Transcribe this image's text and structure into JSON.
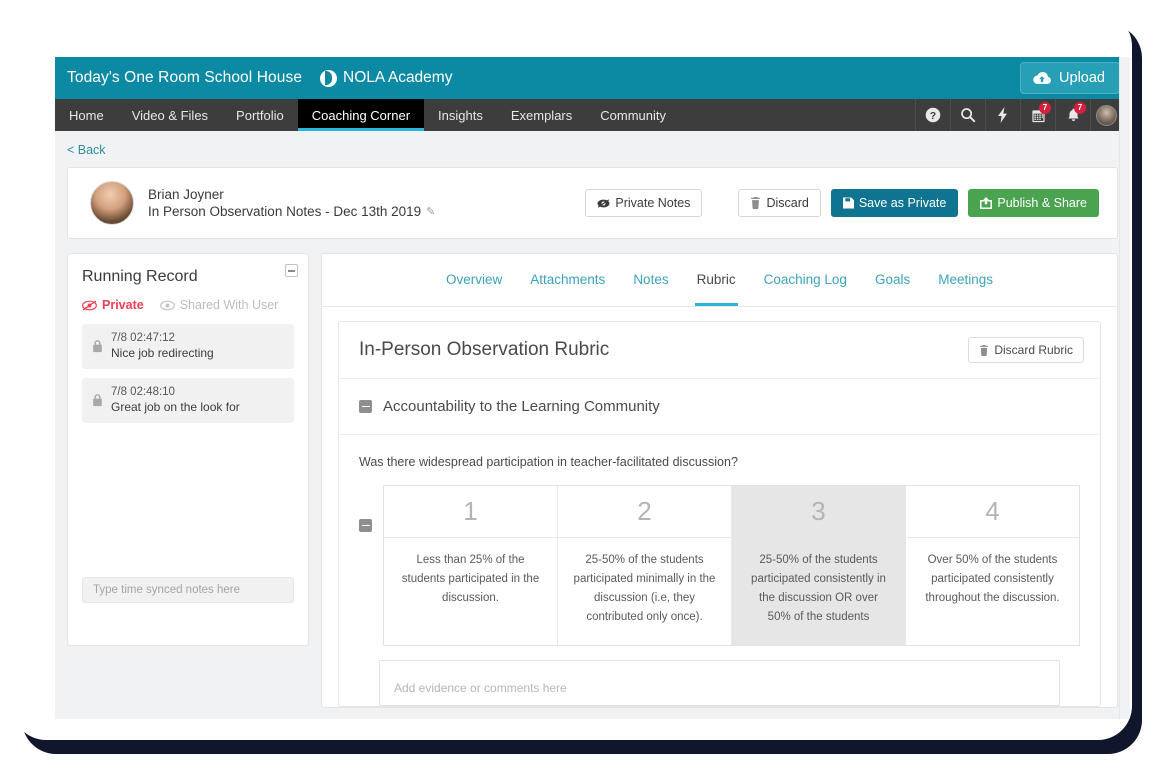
{
  "topbar": {
    "school_name": "Today's One Room School House",
    "academy_name": "NOLA Academy",
    "academy_logo_icon": "split-circle-logo",
    "upload_label": "Upload",
    "upload_icon": "cloud-upload-icon",
    "accent_teal": "#0d8aa3"
  },
  "nav": {
    "items": [
      {
        "label": "Home",
        "active": false
      },
      {
        "label": "Video & Files",
        "active": false
      },
      {
        "label": "Portfolio",
        "active": false
      },
      {
        "label": "Coaching Corner",
        "active": true
      },
      {
        "label": "Insights",
        "active": false
      },
      {
        "label": "Exemplars",
        "active": false
      },
      {
        "label": "Community",
        "active": false
      }
    ],
    "icons": [
      {
        "name": "help-icon",
        "badge": ""
      },
      {
        "name": "search-icon",
        "badge": ""
      },
      {
        "name": "lightning-icon",
        "badge": ""
      },
      {
        "name": "calendar-icon",
        "badge": "7"
      },
      {
        "name": "bell-icon",
        "badge": "7"
      }
    ],
    "avatar_icon": "user-avatar",
    "caret_icon": "chevron-down-icon",
    "active_underline_color": "#29b6d8",
    "badge_color": "#d6203b"
  },
  "back": {
    "label": "< Back"
  },
  "profile": {
    "avatar_icon": "user-avatar",
    "name": "Brian Joyner",
    "subtitle": "In Person Observation Notes - Dec 13th 2019",
    "edit_icon": "pencil-icon",
    "buttons": [
      {
        "label": "Private Notes",
        "icon": "eye-slash-icon",
        "style": "light"
      },
      {
        "label": "Discard",
        "icon": "trash-icon",
        "style": "light"
      },
      {
        "label": "Save as Private",
        "icon": "floppy-disk-icon",
        "style": "teal"
      },
      {
        "label": "Publish & Share",
        "icon": "share-icon",
        "style": "green"
      }
    ]
  },
  "sidebar": {
    "title": "Running Record",
    "collapse_icon": "collapse-minus-icon",
    "privacy": {
      "private_label": "Private",
      "private_icon": "eye-slash-icon",
      "private_color": "#ef4055",
      "shared_label": "Shared With User",
      "shared_icon": "eye-open-icon"
    },
    "notes": [
      {
        "time": "7/8  02:47:12",
        "text": "Nice job redirecting",
        "icon": "lock-icon"
      },
      {
        "time": "7/8  02:48:10",
        "text": "Great job on the look for",
        "icon": "lock-icon"
      }
    ],
    "note_input_placeholder": "Type time synced notes here"
  },
  "main": {
    "tabs": [
      {
        "label": "Overview",
        "active": false
      },
      {
        "label": "Attachments",
        "active": false
      },
      {
        "label": "Notes",
        "active": false
      },
      {
        "label": "Rubric",
        "active": true
      },
      {
        "label": "Coaching Log",
        "active": false
      },
      {
        "label": "Goals",
        "active": false
      },
      {
        "label": "Meetings",
        "active": false
      }
    ],
    "rubric_title": "In-Person Observation Rubric",
    "discard_rubric_label": "Discard Rubric",
    "discard_rubric_icon": "trash-icon",
    "section_label": "Accountability to the Learning Community",
    "section_toggle_icon": "collapse-minus-icon",
    "question": "Was there widespread participation in teacher-facilitated discussion?",
    "row_toggle_icon": "collapse-minus-icon",
    "columns": [
      {
        "score": "1",
        "description": "Less than 25% of the students participated in the discussion.",
        "selected": false
      },
      {
        "score": "2",
        "description": "25-50% of the students participated minimally in the discussion (i.e, they contributed only once).",
        "selected": false
      },
      {
        "score": "3",
        "description": "25-50% of the students participated consistently in the discussion OR over 50% of the students",
        "selected": true
      },
      {
        "score": "4",
        "description": "Over 50% of the students participated consistently throughout the discussion.",
        "selected": false
      }
    ],
    "evidence_placeholder": "Add evidence or comments here"
  }
}
